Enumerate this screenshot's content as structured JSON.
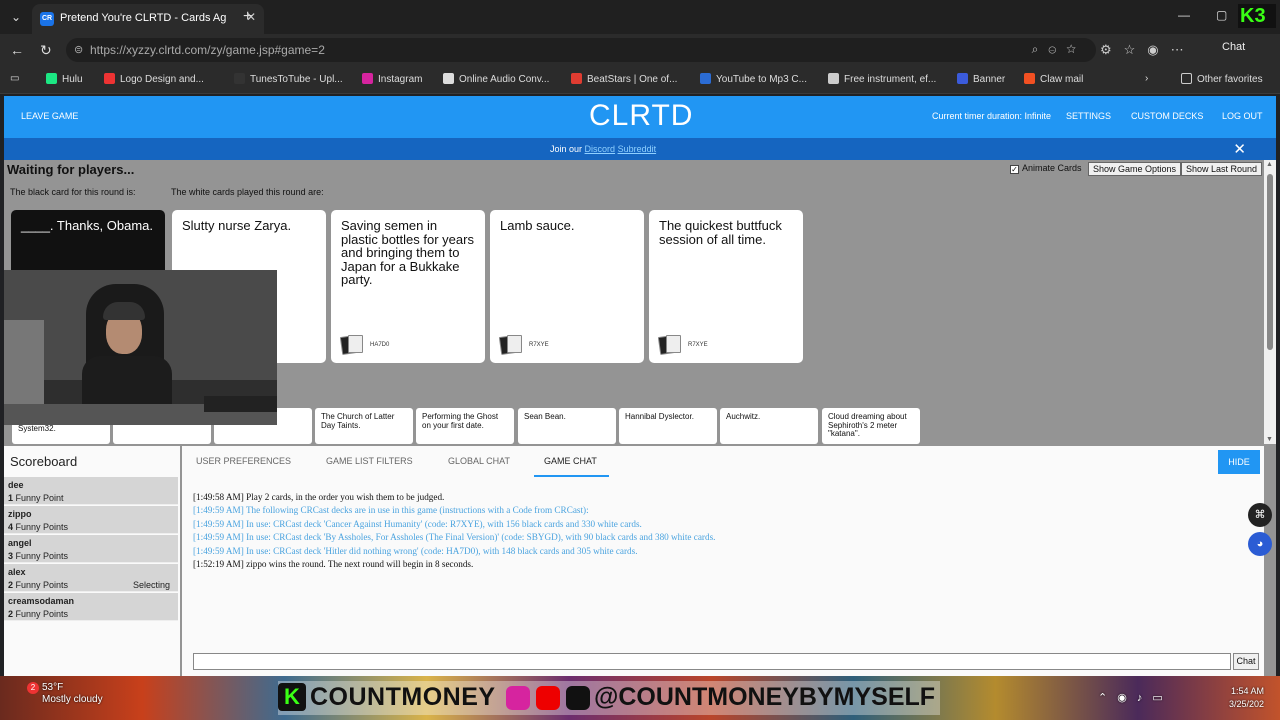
{
  "browser": {
    "tab_title": "Pretend You're CLRTD - Cards Ag",
    "url": "https://xyzzy.clrtd.com/zy/game.jsp#game=2",
    "chat_button": "Chat",
    "bookmarks": [
      "Hulu",
      "Logo Design and...",
      "TunesToTube - Upl...",
      "Instagram",
      "Online Audio Conv...",
      "BeatStars | One of...",
      "YouTube to Mp3 C...",
      "Free instrument, ef...",
      "Banner",
      "Claw mail"
    ],
    "other_favorites": "Other favorites"
  },
  "nav": {
    "leave_game": "LEAVE GAME",
    "logo": "CLRTD",
    "timer": "Current timer duration: Infinite",
    "settings": "SETTINGS",
    "custom_decks": "CUSTOM DECKS",
    "log_out": "LOG OUT"
  },
  "banner": {
    "prefix": "Join our",
    "discord": "Discord",
    "subreddit": "Subreddit",
    "close": "✕"
  },
  "game": {
    "status": "Waiting for players...",
    "animate_cards": "Animate Cards",
    "show_game_options": "Show Game Options",
    "show_last_round": "Show Last Round",
    "black_label": "The black card for this round is:",
    "white_label": "The white cards played this round are:",
    "black_card": "____. Thanks, Obama.",
    "white_cards": [
      {
        "text": "Slutty nurse Zarya.",
        "code": ""
      },
      {
        "text": "Saving semen in plastic bottles for years and bringing them to Japan for a Bukkake party.",
        "code": "HA7D0"
      },
      {
        "text": "Lamb sauce.",
        "code": "R7XYE"
      },
      {
        "text": "The quickest buttfuck session of all time.",
        "code": "R7XYE"
      }
    ],
    "hand_cards": [
      "System32.",
      "",
      "",
      "The Church of Latter Day Taints.",
      "Performing the Ghost on your first date.",
      "Sean Bean.",
      "Hannibal Dyslector.",
      "Auchwitz.",
      "Cloud dreaming about Sephiroth's 2 meter \"katana\"."
    ]
  },
  "scoreboard": {
    "title": "Scoreboard",
    "players": [
      {
        "name": "dee",
        "points": "1",
        "label": "Funny Point",
        "state": ""
      },
      {
        "name": "zippo",
        "points": "4",
        "label": "Funny Points",
        "state": ""
      },
      {
        "name": "angel",
        "points": "3",
        "label": "Funny Points",
        "state": ""
      },
      {
        "name": "alex",
        "points": "2",
        "label": "Funny Points",
        "state": "Selecting"
      },
      {
        "name": "creamsodaman",
        "points": "2",
        "label": "Funny Points",
        "state": ""
      }
    ]
  },
  "panel": {
    "tabs": [
      "USER PREFERENCES",
      "GAME LIST FILTERS",
      "GLOBAL CHAT",
      "GAME CHAT"
    ],
    "hide": "HIDE",
    "chat_send": "Chat",
    "messages": [
      {
        "time": "[1:49:58 AM]",
        "text": "Play 2 cards, in the order you wish them to be judged."
      },
      {
        "time": "[1:49:59 AM]",
        "text": "The following CRCast decks are in use in this game (instructions with a Code from CRCast):"
      },
      {
        "time": "[1:49:59 AM]",
        "text": "In use: CRCast deck 'Cancer Against Humanity' (code: R7XYE), with 156 black cards and 330 white cards."
      },
      {
        "time": "[1:49:59 AM]",
        "text": "In use: CRCast deck 'By Assholes, For Assholes (The Final Version)' (code: SBYGD), with 90 black cards and 380 white cards."
      },
      {
        "time": "[1:49:59 AM]",
        "text": "In use: CRCast deck 'Hitler did nothing wrong' (code: HA7D0), with 148 black cards and 305 white cards."
      },
      {
        "time": "[1:52:19 AM]",
        "text": "zippo wins the round. The next round will begin in 8 seconds."
      }
    ]
  },
  "taskbar": {
    "weather_temp": "53°F",
    "weather_desc": "Mostly cloudy",
    "weather_badge": "2",
    "overlay_name": "COUNTMONEY",
    "overlay_handle": "@COUNTMONEYBYMYSELF",
    "time": "1:54 AM",
    "date": "3/25/202"
  }
}
